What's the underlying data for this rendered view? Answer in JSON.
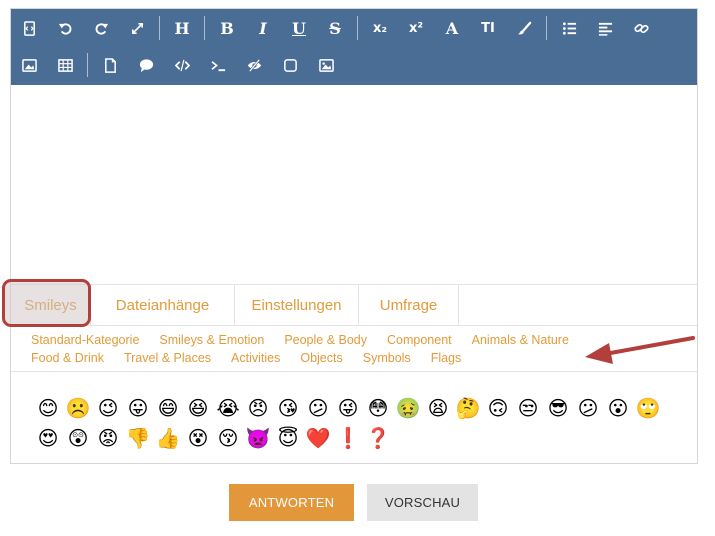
{
  "toolbar": {
    "row1": [
      {
        "name": "source-code-icon",
        "kind": "icon"
      },
      {
        "name": "undo-icon",
        "kind": "icon"
      },
      {
        "name": "redo-icon",
        "kind": "icon"
      },
      {
        "name": "fullscreen-icon",
        "kind": "icon"
      },
      {
        "name": "sep"
      },
      {
        "name": "heading-icon",
        "kind": "text",
        "label": "H"
      },
      {
        "name": "sep"
      },
      {
        "name": "bold-icon",
        "kind": "text",
        "label": "B"
      },
      {
        "name": "italic-icon",
        "kind": "text",
        "label": "I"
      },
      {
        "name": "underline-icon",
        "kind": "text",
        "label": "U"
      },
      {
        "name": "strikethrough-icon",
        "kind": "text",
        "label": "S"
      },
      {
        "name": "sep"
      },
      {
        "name": "subscript-icon",
        "kind": "text",
        "label": "x₂"
      },
      {
        "name": "superscript-icon",
        "kind": "text",
        "label": "x²"
      },
      {
        "name": "font-color-icon",
        "kind": "text",
        "label": "A"
      },
      {
        "name": "font-size-icon",
        "kind": "text",
        "label": "TI"
      },
      {
        "name": "brush-icon",
        "kind": "icon"
      },
      {
        "name": "sep"
      },
      {
        "name": "list-icon",
        "kind": "icon"
      },
      {
        "name": "align-left-icon",
        "kind": "icon"
      },
      {
        "name": "link-icon",
        "kind": "icon"
      }
    ],
    "row2": [
      {
        "name": "image-icon",
        "kind": "icon"
      },
      {
        "name": "table-icon",
        "kind": "icon"
      },
      {
        "name": "sep"
      },
      {
        "name": "file-icon",
        "kind": "icon"
      },
      {
        "name": "comment-icon",
        "kind": "icon"
      },
      {
        "name": "code-icon",
        "kind": "icon"
      },
      {
        "name": "terminal-icon",
        "kind": "icon"
      },
      {
        "name": "spoiler-eye-icon",
        "kind": "icon"
      },
      {
        "name": "checkbox-icon",
        "kind": "icon"
      },
      {
        "name": "gallery-image-icon",
        "kind": "icon"
      }
    ]
  },
  "tabs": [
    {
      "label": "Smileys",
      "active": true
    },
    {
      "label": "Dateianhänge"
    },
    {
      "label": "Einstellungen"
    },
    {
      "label": "Umfrage"
    }
  ],
  "categories": {
    "row1": [
      "Standard-Kategorie",
      "Smileys & Emotion",
      "People & Body",
      "Component",
      "Animals & Nature"
    ],
    "row2": [
      "Food & Drink",
      "Travel & Places",
      "Activities",
      "Objects",
      "Symbols",
      "Flags"
    ]
  },
  "emojis": {
    "row1": [
      "😊",
      "☹️",
      "😉",
      "😛",
      "😄",
      "😆",
      "😭",
      "😠",
      "😘",
      "😕",
      "😜",
      "😳",
      "🤢",
      "😫",
      "🤔",
      "🙃",
      "😒",
      "😎",
      "😕",
      "😮",
      "🙄"
    ],
    "row2": [
      "😍",
      "😲",
      "😡",
      "👎",
      "👍",
      "😵",
      "😚",
      "👿",
      "😇",
      "❤️",
      "❗",
      "❓"
    ]
  },
  "actions": {
    "reply_label": "ANTWORTEN",
    "preview_label": "VORSCHAU"
  },
  "colors": {
    "toolbar_bg": "#4a6d96",
    "accent": "#e2973a",
    "highlight": "#b23f3c"
  }
}
